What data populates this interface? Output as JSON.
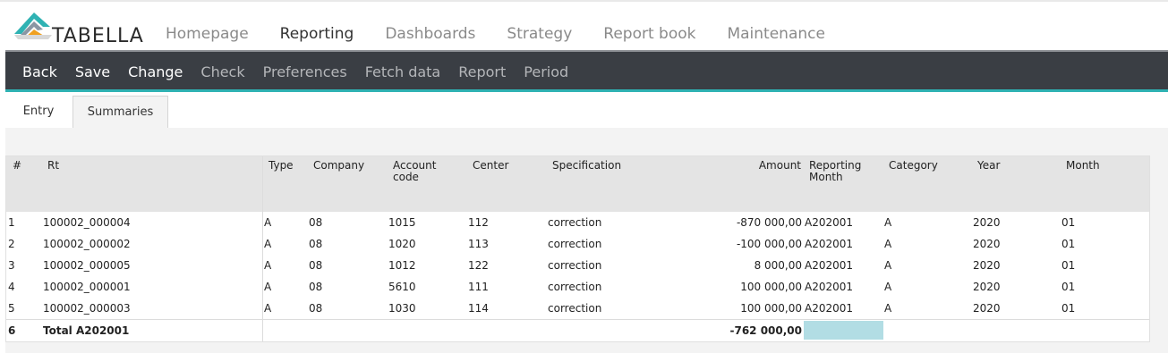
{
  "app": {
    "logo_text": "TABELLA",
    "colors": {
      "toolbar_bg": "#3a3e44",
      "accent": "#2fb2b3",
      "highlight": "#b2dde4"
    }
  },
  "topnav": [
    {
      "label": "Homepage",
      "active": false
    },
    {
      "label": "Reporting",
      "active": true
    },
    {
      "label": "Dashboards",
      "active": false
    },
    {
      "label": "Strategy",
      "active": false
    },
    {
      "label": "Report book",
      "active": false
    },
    {
      "label": "Maintenance",
      "active": false
    }
  ],
  "toolbar": [
    {
      "label": "Back",
      "enabled": true
    },
    {
      "label": "Save",
      "enabled": true
    },
    {
      "label": "Change",
      "enabled": true
    },
    {
      "label": "Check",
      "enabled": false
    },
    {
      "label": "Preferences",
      "enabled": false
    },
    {
      "label": "Fetch data",
      "enabled": false
    },
    {
      "label": "Report",
      "enabled": false
    },
    {
      "label": "Period",
      "enabled": false
    }
  ],
  "tabs": [
    {
      "label": "Entry",
      "active": false
    },
    {
      "label": "Summaries",
      "active": true
    }
  ],
  "table": {
    "headers": {
      "num": "#",
      "rt": "Rt",
      "type": "Type",
      "company": "Company",
      "account_code": [
        "Account",
        "code"
      ],
      "center": "Center",
      "specification": "Specification",
      "amount": "Amount",
      "reporting_month": [
        "Reporting",
        "Month"
      ],
      "category": "Category",
      "year": "Year",
      "month": "Month"
    },
    "rows": [
      {
        "num": "1",
        "rt": "100002_000004",
        "type": "A",
        "company": "08",
        "account_code": "1015",
        "center": "112",
        "specification": "correction",
        "amount": "-870 000,00",
        "reporting_month": "A202001",
        "category": "A",
        "year": "2020",
        "month": "01"
      },
      {
        "num": "2",
        "rt": "100002_000002",
        "type": "A",
        "company": "08",
        "account_code": "1020",
        "center": "113",
        "specification": "correction",
        "amount": "-100 000,00",
        "reporting_month": "A202001",
        "category": "A",
        "year": "2020",
        "month": "01"
      },
      {
        "num": "3",
        "rt": "100002_000005",
        "type": "A",
        "company": "08",
        "account_code": "1012",
        "center": "122",
        "specification": "correction",
        "amount": "8 000,00",
        "reporting_month": "A202001",
        "category": "A",
        "year": "2020",
        "month": "01"
      },
      {
        "num": "4",
        "rt": "100002_000001",
        "type": "A",
        "company": "08",
        "account_code": "5610",
        "center": "111",
        "specification": "correction",
        "amount": "100 000,00",
        "reporting_month": "A202001",
        "category": "A",
        "year": "2020",
        "month": "01"
      },
      {
        "num": "5",
        "rt": "100002_000003",
        "type": "A",
        "company": "08",
        "account_code": "1030",
        "center": "114",
        "specification": "correction",
        "amount": "100 000,00",
        "reporting_month": "A202001",
        "category": "A",
        "year": "2020",
        "month": "01"
      }
    ],
    "total": {
      "num": "6",
      "label": "Total A202001",
      "amount": "-762 000,00"
    }
  }
}
